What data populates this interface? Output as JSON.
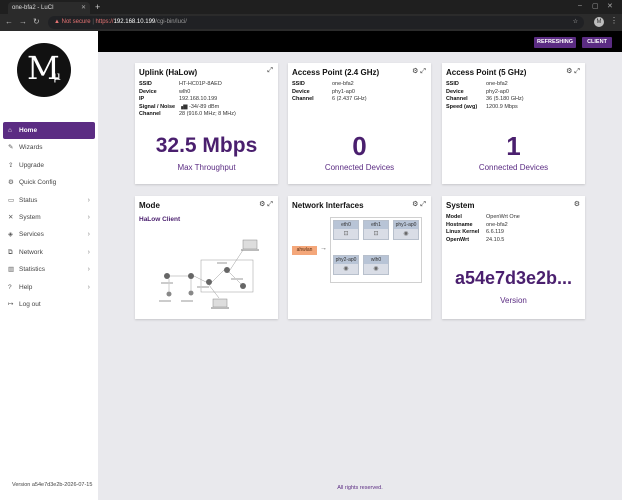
{
  "browser": {
    "tab_title": "one-bfa2 - LuCI",
    "new_tab": "+",
    "security_label": "Not secure",
    "url_scheme": "https://",
    "url_host": "192.168.10.199",
    "url_path": "/cgi-bin/luci/",
    "profile_initial": "M"
  },
  "sidebar": {
    "logo": {
      "main": "M",
      "sub": "μ"
    },
    "items": [
      {
        "label": "Home",
        "icon": "home-icon",
        "active": true,
        "expandable": false
      },
      {
        "label": "Wizards",
        "icon": "wizard-icon",
        "active": false,
        "expandable": false
      },
      {
        "label": "Upgrade",
        "icon": "upgrade-icon",
        "active": false,
        "expandable": false
      },
      {
        "label": "Quick Config",
        "icon": "gear-icon",
        "active": false,
        "expandable": false
      },
      {
        "label": "Status",
        "icon": "folder-icon",
        "active": false,
        "expandable": true
      },
      {
        "label": "System",
        "icon": "tools-icon",
        "active": false,
        "expandable": true
      },
      {
        "label": "Services",
        "icon": "services-icon",
        "active": false,
        "expandable": true
      },
      {
        "label": "Network",
        "icon": "network-icon",
        "active": false,
        "expandable": true
      },
      {
        "label": "Statistics",
        "icon": "chart-icon",
        "active": false,
        "expandable": true
      },
      {
        "label": "Help",
        "icon": "help-icon",
        "active": false,
        "expandable": true
      },
      {
        "label": "Log out",
        "icon": "logout-icon",
        "active": false,
        "expandable": false
      }
    ],
    "version": "Version a54e7d3e2b-2026-07-15"
  },
  "topbar": {
    "refreshing": "REFRESHING",
    "client": "CLIENT"
  },
  "cards": {
    "uplink": {
      "title": "Uplink (HaLow)",
      "rows": [
        {
          "k": "SSID",
          "v": "HT-HC01P-8AED"
        },
        {
          "k": "Device",
          "v": "wlh0"
        },
        {
          "k": "IP",
          "v": "192.168.10.199"
        },
        {
          "k": "Signal / Noise",
          "v": "-34/-89 dBm"
        },
        {
          "k": "Channel",
          "v": "28 (916.0 MHz; 8 MHz)"
        }
      ],
      "value": "32.5 Mbps",
      "caption": "Max Throughput"
    },
    "ap24": {
      "title": "Access Point (2.4 GHz)",
      "rows": [
        {
          "k": "SSID",
          "v": "one-bfa2"
        },
        {
          "k": "Device",
          "v": "phy1-ap0"
        },
        {
          "k": "Channel",
          "v": "6 (2.437 GHz)"
        }
      ],
      "value": "0",
      "caption": "Connected Devices"
    },
    "ap5": {
      "title": "Access Point (5 GHz)",
      "rows": [
        {
          "k": "SSID",
          "v": "one-bfa2"
        },
        {
          "k": "Device",
          "v": "phy2-ap0"
        },
        {
          "k": "Channel",
          "v": "36 (5.180 GHz)"
        },
        {
          "k": "Speed (avg)",
          "v": "1200.9 Mbps"
        }
      ],
      "value": "1",
      "caption": "Connected Devices"
    },
    "mode": {
      "title": "Mode",
      "label": "HaLow Client"
    },
    "netif": {
      "title": "Network Interfaces",
      "zone": "ahwlan",
      "interfaces": [
        "eth0",
        "eth1",
        "phy1-ap0",
        "phy2-ap0",
        "wlh0"
      ]
    },
    "system": {
      "title": "System",
      "rows": [
        {
          "k": "Model",
          "v": "OpenWrt One"
        },
        {
          "k": "Hostname",
          "v": "one-bfa2"
        },
        {
          "k": "Linux Kernel",
          "v": "6.6.119"
        },
        {
          "k": "OpenWrt",
          "v": "24.10.5"
        }
      ],
      "value": "a54e7d3e2b...",
      "caption": "Version"
    }
  },
  "footer": "All rights reserved."
}
